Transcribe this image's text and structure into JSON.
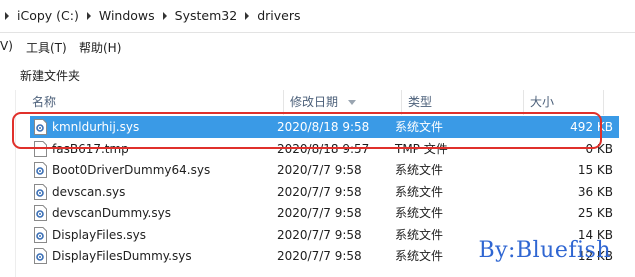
{
  "address": {
    "crumbs": [
      "iCopy (C:)",
      "Windows",
      "System32",
      "drivers"
    ]
  },
  "menu": {
    "item_view": "V)",
    "item_tools": "工具(T)",
    "item_help": "帮助(H)"
  },
  "toolbar": {
    "new_folder_label": "新建文件夹"
  },
  "columns": {
    "name": "名称",
    "modified": "修改日期",
    "type": "类型",
    "size": "大小"
  },
  "files": [
    {
      "name": "kmnldurhij.sys",
      "modified": "2020/8/18 9:58",
      "type": "系统文件",
      "size": "492 KB",
      "selected": true,
      "icon": "sys-file-icon"
    },
    {
      "name": "fasB617.tmp",
      "modified": "2020/8/18 9:57",
      "type": "TMP 文件",
      "size": "0 KB",
      "selected": false,
      "icon": "blank-file-icon"
    },
    {
      "name": "Boot0DriverDummy64.sys",
      "modified": "2020/7/7 9:58",
      "type": "系统文件",
      "size": "15 KB",
      "selected": false,
      "icon": "sys-file-icon"
    },
    {
      "name": "devscan.sys",
      "modified": "2020/7/7 9:58",
      "type": "系统文件",
      "size": "36 KB",
      "selected": false,
      "icon": "sys-file-icon"
    },
    {
      "name": "devscanDummy.sys",
      "modified": "2020/7/7 9:58",
      "type": "系统文件",
      "size": "25 KB",
      "selected": false,
      "icon": "sys-file-icon"
    },
    {
      "name": "DisplayFiles.sys",
      "modified": "2020/7/7 9:58",
      "type": "系统文件",
      "size": "14 KB",
      "selected": false,
      "icon": "sys-file-icon"
    },
    {
      "name": "DisplayFilesDummy.sys",
      "modified": "2020/7/7 9:58",
      "type": "系统文件",
      "size": "12 KB",
      "selected": false,
      "icon": "sys-file-icon"
    }
  ],
  "watermark": "By:Bluefish",
  "colors": {
    "selection": "#3a9ae6",
    "highlight_box": "#e0302b",
    "watermark": "#2f66d2",
    "header_text": "#4c607a"
  }
}
